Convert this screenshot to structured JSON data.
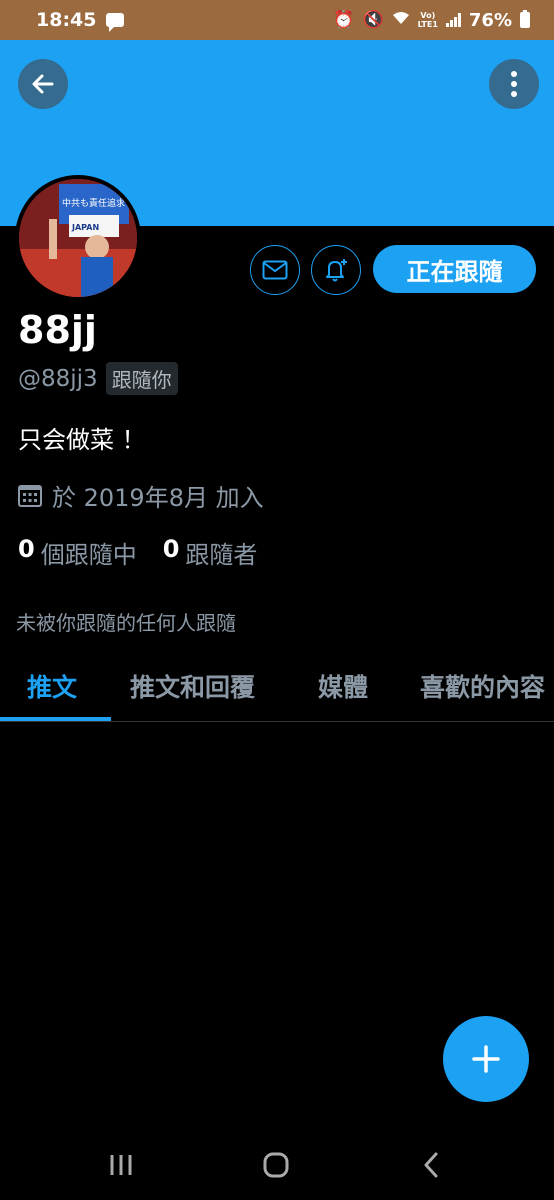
{
  "status_bar": {
    "time": "18:45",
    "battery": "76%",
    "network_top": "Vo)",
    "network_bottom": "LTE1"
  },
  "profile": {
    "display_name": "88jj",
    "handle": "@88jj3",
    "follows_you_badge": "跟隨你",
    "bio": "只会做菜 ！",
    "joined": "於 2019年8月 加入",
    "following_count": "0",
    "following_label": "個跟隨中",
    "followers_count": "0",
    "followers_label": "跟隨者",
    "not_followed_text": "未被你跟隨的任何人跟隨"
  },
  "actions": {
    "follow_button": "正在跟隨"
  },
  "avatar_text": {
    "sign_top": "中共も責任追求",
    "sign_bottom": "JAPAN"
  },
  "tabs": [
    {
      "label": "推文",
      "active": true
    },
    {
      "label": "推文和回覆",
      "active": false
    },
    {
      "label": "媒體",
      "active": false
    },
    {
      "label": "喜歡的內容",
      "active": false
    }
  ],
  "colors": {
    "accent": "#1da1f2",
    "status_bar": "#9b6a3f",
    "background": "#000000",
    "secondary_text": "#8b98a5"
  },
  "icons": {
    "back": "arrow-left-icon",
    "more": "more-vertical-icon",
    "message": "envelope-icon",
    "notify": "bell-plus-icon",
    "calendar": "calendar-icon",
    "compose": "plus-icon"
  }
}
